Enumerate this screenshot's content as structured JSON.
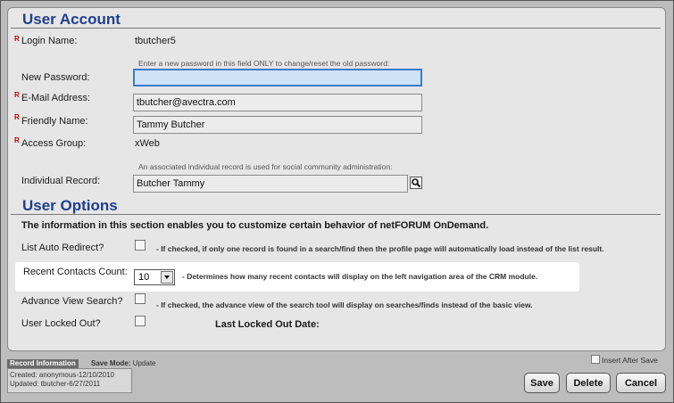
{
  "user_account": {
    "title": "User Account",
    "req_marker": "R",
    "login_name": {
      "label": "Login Name:",
      "value": "tbutcher5"
    },
    "new_password": {
      "label": "New Password:",
      "hint": "Enter a new password in this field ONLY to change/reset the old password:",
      "value": ""
    },
    "email": {
      "label": "E-Mail Address:",
      "value": "tbutcher@avectra.com"
    },
    "friendly_name": {
      "label": "Friendly Name:",
      "value": "Tammy Butcher"
    },
    "access_group": {
      "label": "Access Group:",
      "value": "xWeb"
    },
    "individual_record": {
      "label": "Individual Record:",
      "hint": "An associated individual record is used for social community administration:",
      "value": "Butcher Tammy"
    }
  },
  "user_options": {
    "title": "User Options",
    "intro": "The information in this section enables you to customize certain behavior of netFORUM OnDemand.",
    "list_auto_redirect": {
      "label": "List Auto Redirect?",
      "desc": "- If checked, if only one record is found in a search/find then the profile page will automatically load instead of the list result.",
      "checked": false
    },
    "recent_contacts": {
      "label": "Recent Contacts Count:",
      "value": "10",
      "desc": "- Determines how many recent contacts will display on the left navigation area of the CRM module."
    },
    "advance_view": {
      "label": "Advance View Search?",
      "desc": "- If checked, the advance view of the search tool will display on searches/finds instead of the basic view.",
      "checked": false
    },
    "user_locked_out": {
      "label": "User Locked Out?",
      "checked": false
    },
    "last_locked_out": {
      "label": "Last Locked Out Date:"
    }
  },
  "footer": {
    "record_info": "Record Information",
    "save_mode_label": "Save Mode:",
    "save_mode_value": "Update",
    "created": "Created: anonymous-12/10/2010",
    "updated": "Updated: tbutcher-6/27/2011",
    "insert_after_save": "Insert After Save",
    "buttons": {
      "save": "Save",
      "delete": "Delete",
      "cancel": "Cancel"
    }
  }
}
